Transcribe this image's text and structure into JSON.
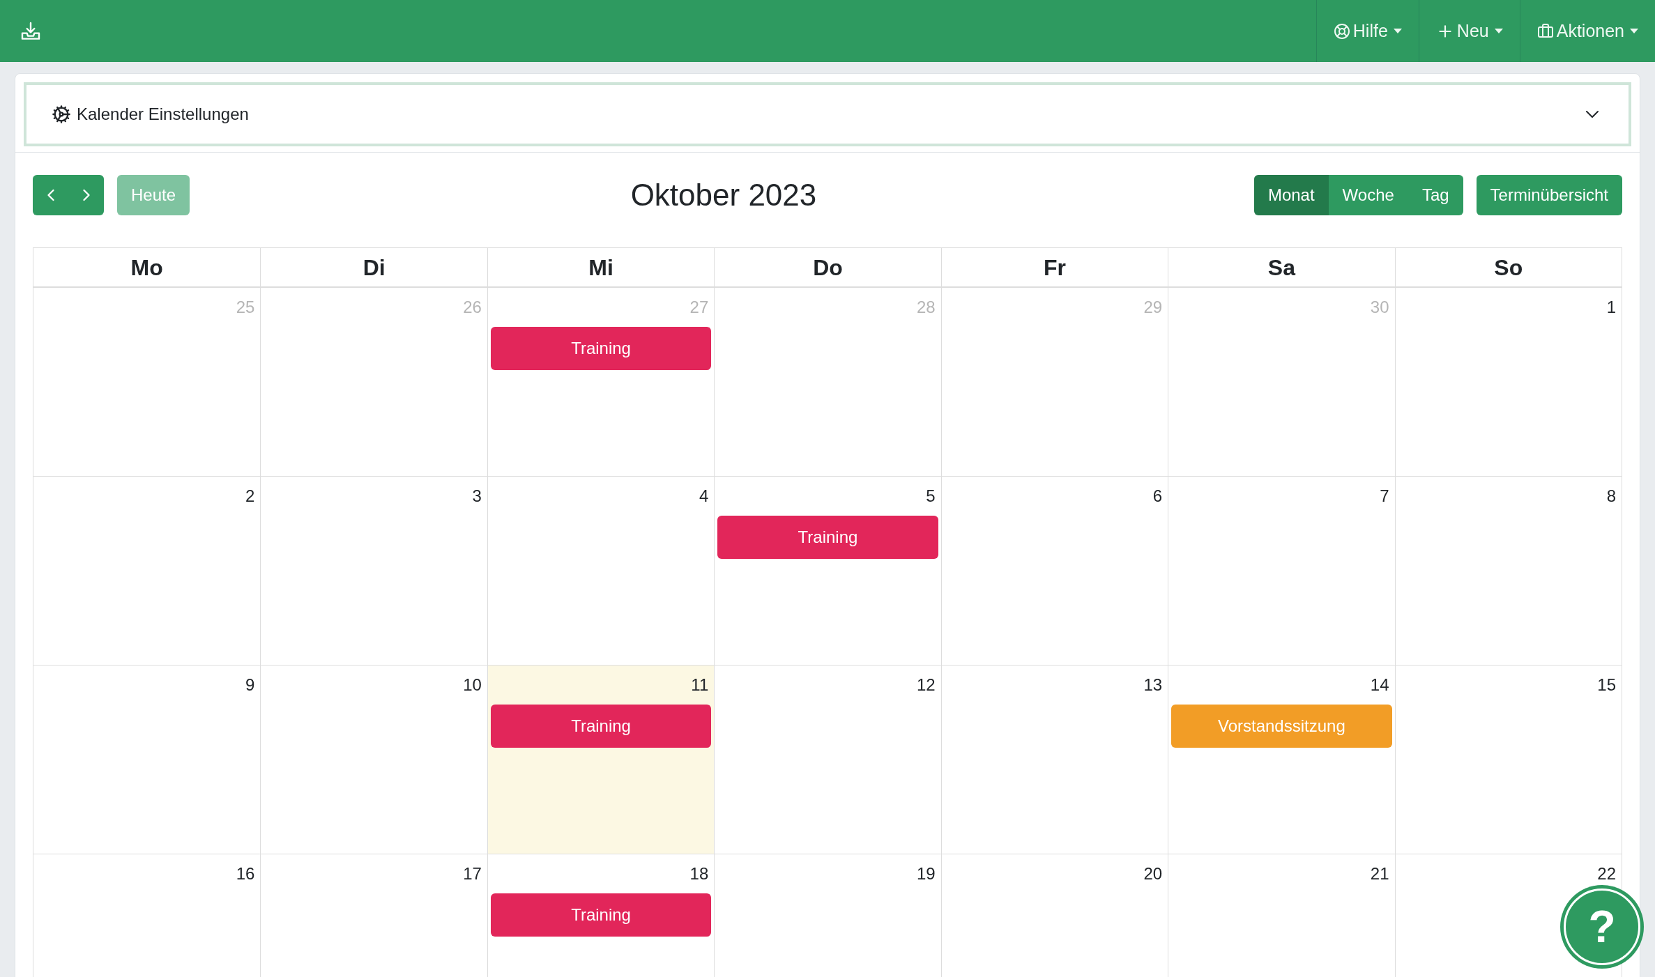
{
  "topbar": {
    "menus": [
      {
        "kind": "help",
        "label": "Hilfe"
      },
      {
        "kind": "new",
        "label": "Neu"
      },
      {
        "kind": "actions",
        "label": "Aktionen"
      }
    ]
  },
  "settings": {
    "label": "Kalender Einstellungen",
    "expanded": false
  },
  "toolbar": {
    "today": {
      "label": "Heute",
      "disabled": true
    },
    "title": "Oktober 2023",
    "views": [
      {
        "label": "Monat",
        "selected": true
      },
      {
        "label": "Woche",
        "selected": false
      },
      {
        "label": "Tag",
        "selected": false
      }
    ],
    "overview": "Terminübersicht"
  },
  "calendar": {
    "weekdays": [
      "Mo",
      "Di",
      "Mi",
      "Do",
      "Fr",
      "Sa",
      "So"
    ],
    "weeks": [
      [
        {
          "day": "25",
          "muted": true,
          "today": false
        },
        {
          "day": "26",
          "muted": true,
          "today": false
        },
        {
          "day": "27",
          "muted": true,
          "today": false,
          "events": [
            {
              "title": "Training",
              "color": "#e2265a"
            }
          ]
        },
        {
          "day": "28",
          "muted": true,
          "today": false
        },
        {
          "day": "29",
          "muted": true,
          "today": false
        },
        {
          "day": "30",
          "muted": true,
          "today": false
        },
        {
          "day": "1",
          "muted": false,
          "today": false
        }
      ],
      [
        {
          "day": "2",
          "muted": false,
          "today": false
        },
        {
          "day": "3",
          "muted": false,
          "today": false
        },
        {
          "day": "4",
          "muted": false,
          "today": false
        },
        {
          "day": "5",
          "muted": false,
          "today": false,
          "events": [
            {
              "title": "Training",
              "color": "#e2265a"
            }
          ]
        },
        {
          "day": "6",
          "muted": false,
          "today": false
        },
        {
          "day": "7",
          "muted": false,
          "today": false
        },
        {
          "day": "8",
          "muted": false,
          "today": false
        }
      ],
      [
        {
          "day": "9",
          "muted": false,
          "today": false
        },
        {
          "day": "10",
          "muted": false,
          "today": false
        },
        {
          "day": "11",
          "muted": false,
          "today": true,
          "events": [
            {
              "title": "Training",
              "color": "#e2265a"
            }
          ]
        },
        {
          "day": "12",
          "muted": false,
          "today": false
        },
        {
          "day": "13",
          "muted": false,
          "today": false
        },
        {
          "day": "14",
          "muted": false,
          "today": false,
          "events": [
            {
              "title": "Vorstandssitzung",
              "color": "#f29d26"
            }
          ]
        },
        {
          "day": "15",
          "muted": false,
          "today": false
        }
      ],
      [
        {
          "day": "16",
          "muted": false,
          "today": false
        },
        {
          "day": "17",
          "muted": false,
          "today": false
        },
        {
          "day": "18",
          "muted": false,
          "today": false,
          "events": [
            {
              "title": "Training",
              "color": "#e2265a"
            }
          ]
        },
        {
          "day": "19",
          "muted": false,
          "today": false
        },
        {
          "day": "20",
          "muted": false,
          "today": false
        },
        {
          "day": "21",
          "muted": false,
          "today": false
        },
        {
          "day": "22",
          "muted": false,
          "today": false
        }
      ]
    ]
  },
  "help_button": {
    "label": "?"
  }
}
